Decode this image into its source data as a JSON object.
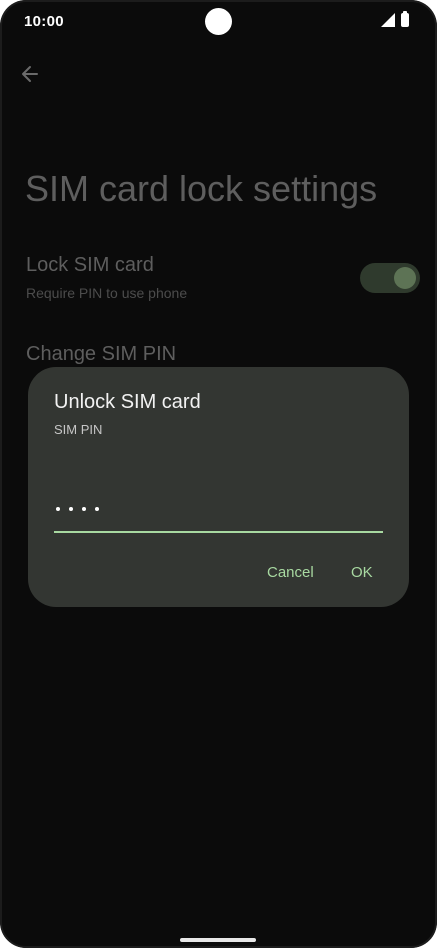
{
  "status_bar": {
    "time": "10:00",
    "icons": [
      "signal-icon",
      "battery-icon"
    ]
  },
  "page": {
    "title": "SIM card lock settings",
    "lock_sim": {
      "title": "Lock SIM card",
      "summary": "Require PIN to use phone",
      "enabled": true
    },
    "change_pin": {
      "label": "Change SIM PIN"
    }
  },
  "dialog": {
    "title": "Unlock SIM card",
    "subtitle": "SIM PIN",
    "pin_value": "••••",
    "cancel_label": "Cancel",
    "ok_label": "OK"
  },
  "colors": {
    "background": "#0b0b0b",
    "dialog_background": "#333632",
    "accent": "#a8d9a1"
  }
}
